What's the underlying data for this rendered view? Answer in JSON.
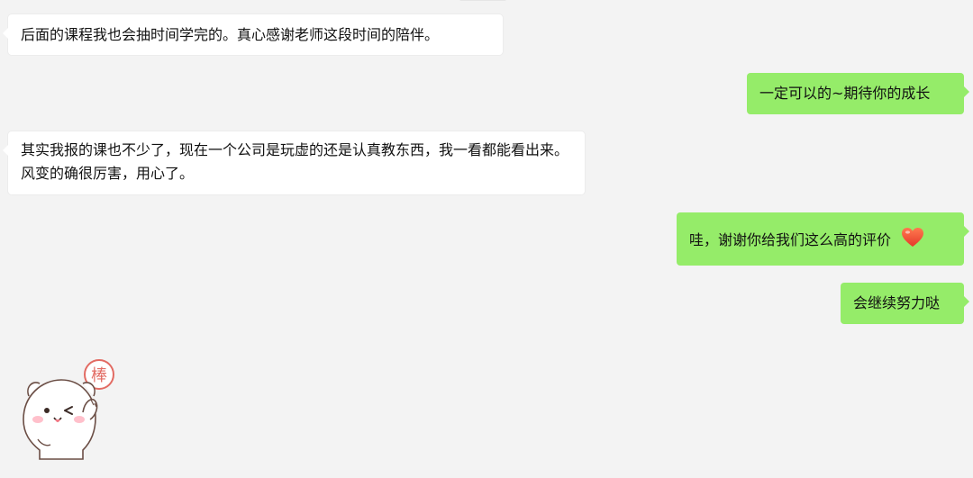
{
  "messages": [
    {
      "side": "left",
      "text": "后面的课程我也会抽时间学完的。真心感谢老师这段时间的陪伴。"
    },
    {
      "side": "right",
      "text": "一定可以的~期待你的成长"
    },
    {
      "side": "left",
      "text": "其实我报的课也不少了，现在一个公司是玩虚的还是认真教东西，我一看都能看出来。风变的确很厉害，用心了。"
    },
    {
      "side": "right",
      "text": "哇，谢谢你给我们这么高的评价",
      "emoji": "heart-icon"
    },
    {
      "side": "right",
      "text": "会继续努力哒"
    }
  ],
  "sticker": {
    "stamp_text": "棒",
    "icon": "cute-bear-sticker"
  },
  "colors": {
    "background": "#f3f3f3",
    "self_bubble": "#95ec69",
    "other_bubble": "#ffffff",
    "heart": "#f0502f",
    "stamp": "#e26b63"
  }
}
